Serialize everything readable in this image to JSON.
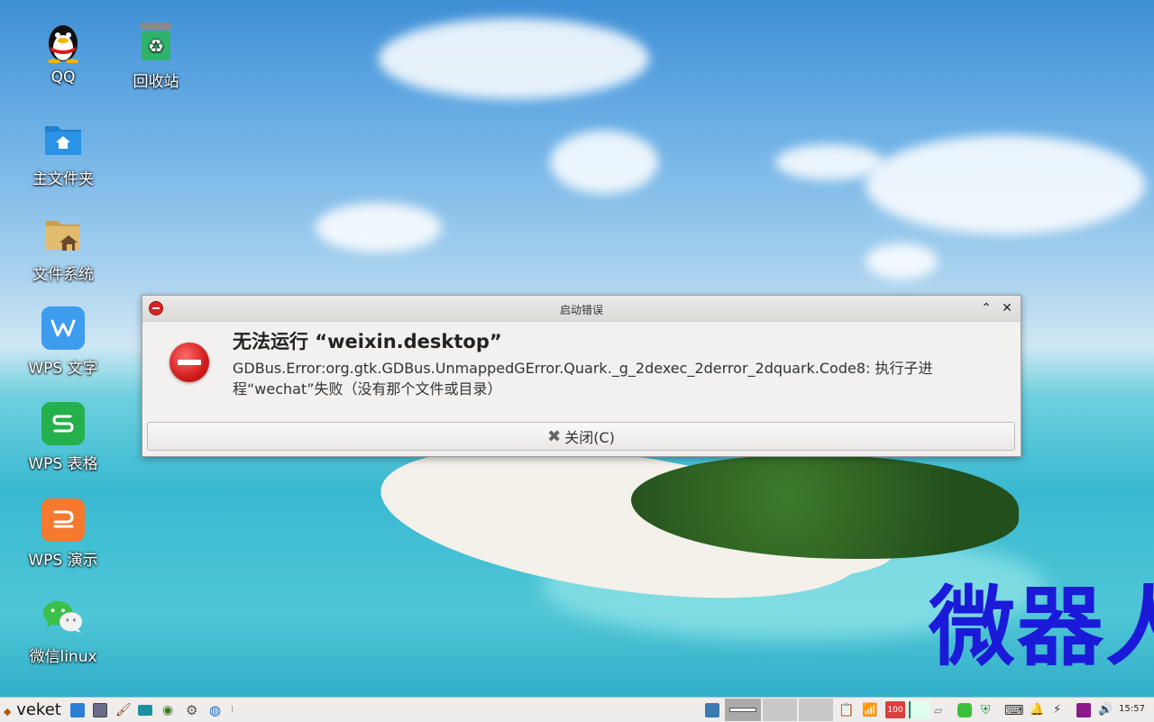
{
  "desktop": {
    "icons": [
      {
        "label": "QQ",
        "icon": "qq-penguin-icon"
      },
      {
        "label": "回收站",
        "icon": "recycle-bin-icon"
      },
      {
        "label": "主文件夹",
        "icon": "home-folder-icon"
      },
      {
        "label": "文件系统",
        "icon": "file-system-icon"
      },
      {
        "label": "WPS 文字",
        "icon": "wps-writer-icon"
      },
      {
        "label": "WPS 表格",
        "icon": "wps-spreadsheet-icon"
      },
      {
        "label": "WPS 演示",
        "icon": "wps-presentation-icon"
      },
      {
        "label": "微信linux",
        "icon": "wechat-icon"
      }
    ],
    "wallpaper_text": "微器人"
  },
  "dialog": {
    "title": "启动错误",
    "heading": "无法运行 “weixin.desktop”",
    "message": "GDBus.Error:org.gtk.GDBus.UnmappedGError.Quark._g_2dexec_2derror_2dquark.Code8: 执行子进程“wechat”失败（没有那个文件或目录）",
    "close_label": "关闭(C)"
  },
  "taskbar": {
    "menu_label": "veket",
    "tray_badge": "100",
    "clock": "15:57"
  },
  "colors": {
    "error_red": "#d21c1c",
    "wallpaper_text": "#1a1ad8",
    "taskbar_bg": "#eeedec"
  }
}
